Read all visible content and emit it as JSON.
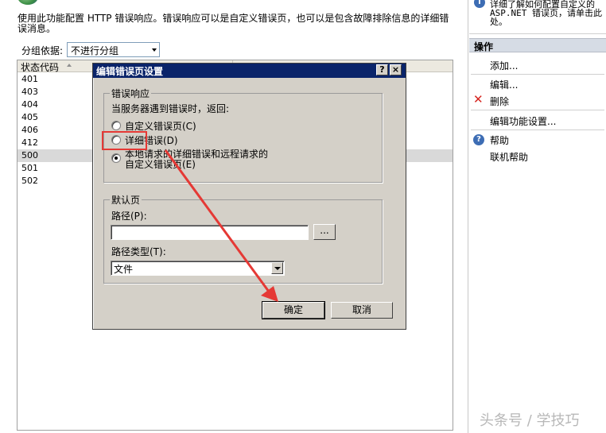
{
  "description": "使用此功能配置 HTTP 错误响应。错误响应可以是自定义错误页，也可以是包含故障排除信息的详细错误消息。",
  "group_by": {
    "label": "分组依据:",
    "value": "不进行分组"
  },
  "grid": {
    "column_status_code": "状态代码",
    "rows": [
      "401",
      "403",
      "404",
      "405",
      "406",
      "412",
      "500",
      "501",
      "502"
    ],
    "selected_row": "500"
  },
  "info": {
    "text": "详细了解如何配置自定义的\nASP.NET 错误页，请单击此\n处。"
  },
  "actions": {
    "header": "操作",
    "add": "添加...",
    "edit": "编辑...",
    "delete": "删除",
    "edit_feature_settings": "编辑功能设置...",
    "help": "帮助",
    "online_help": "联机帮助"
  },
  "dialog": {
    "title": "编辑错误页设置",
    "help_button": "?",
    "close_button": "×",
    "error_response_group": "错误响应",
    "prompt": "当服务器遇到错误时，返回:",
    "option_custom": "自定义错误页(C)",
    "option_detailed": "详细错误(D)",
    "option_local_detailed_line1": "本地请求的详细错误和远程请求的",
    "option_local_detailed_line2": "自定义错误页(E)",
    "selected_option": "option_local_detailed",
    "default_page_group": "默认页",
    "path_label": "路径(P):",
    "path_value": "",
    "browse_button": "...",
    "path_type_label": "路径类型(T):",
    "path_type_value": "文件",
    "ok_button": "确定",
    "cancel_button": "取消"
  },
  "watermark": "头条号 / 学技巧",
  "colors": {
    "titlebar": "#0a246a",
    "annotation": "#e53935",
    "dialog_bg": "#d4d0c8"
  }
}
